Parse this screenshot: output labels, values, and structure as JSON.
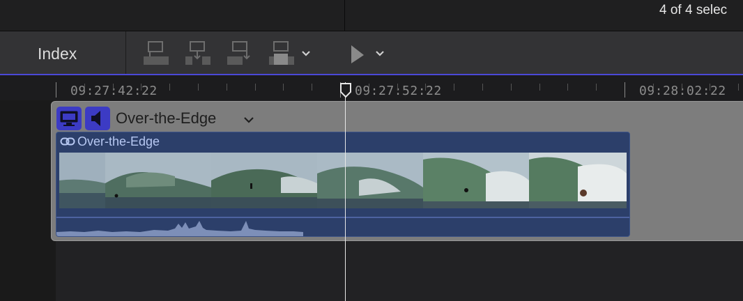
{
  "header": {
    "selection_count": "4 of 4 selec"
  },
  "toolbar": {
    "index_label": "Index",
    "buttons": [
      {
        "name": "connect-clip",
        "icon": "connect-clip-icon"
      },
      {
        "name": "insert-clip",
        "icon": "insert-clip-icon"
      },
      {
        "name": "append-clip",
        "icon": "append-clip-icon"
      },
      {
        "name": "overwrite-clip",
        "icon": "overwrite-clip-icon"
      },
      {
        "name": "edit-mode-menu",
        "icon": "chevron-down-icon"
      },
      {
        "name": "select-tool",
        "icon": "arrow-tool-icon"
      },
      {
        "name": "tool-menu",
        "icon": "chevron-down-icon"
      }
    ]
  },
  "ruler": {
    "timecodes": [
      "09:27:42:22",
      "09:27:52:22",
      "09:28:02:22"
    ]
  },
  "timeline": {
    "compound_clip": {
      "title": "Over-the-Edge",
      "video_badge_icon": "monitor-icon",
      "audio_badge_icon": "speaker-icon"
    },
    "clip": {
      "name": "Over-the-Edge",
      "link_icon": "link-icon",
      "thumbnail_count": 6
    }
  },
  "colors": {
    "accent": "#4b49d8",
    "clip_fill": "#2c3f6a",
    "clip_text": "#b7c8f2",
    "badge": "#3c3bc4"
  }
}
